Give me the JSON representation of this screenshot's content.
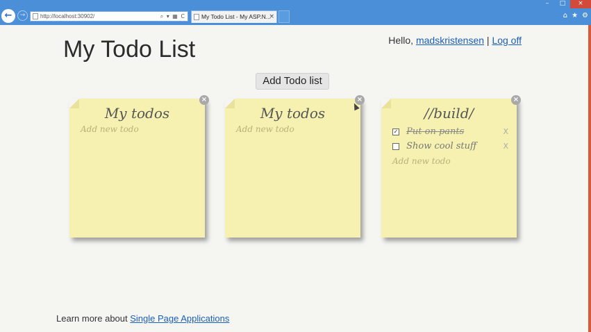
{
  "browser": {
    "address": "http://localhost:30902/",
    "tab_title": "My Todo List - My ASP.N...",
    "tab_close": "×",
    "address_tools": "⌕ ▾ ▦ C",
    "window_controls": {
      "minimize": "–",
      "maximize": "□",
      "close": "×"
    },
    "icons": [
      "home-icon",
      "star-icon",
      "gear-icon"
    ]
  },
  "page": {
    "title": "My Todo List",
    "greeting": "Hello,",
    "username": "madskristensen",
    "separator": "|",
    "logoff": "Log off",
    "add_list_button": "Add Todo list"
  },
  "lists": [
    {
      "title": "My todos",
      "items": [],
      "add_placeholder": "Add new todo"
    },
    {
      "title": "My todos",
      "items": [],
      "add_placeholder": "Add new todo"
    },
    {
      "title": "//build/",
      "items": [
        {
          "text": "Put on pants",
          "done": true,
          "check": "✓",
          "delete": "X"
        },
        {
          "text": "Show cool stuff",
          "done": false,
          "check": "",
          "delete": "X"
        }
      ],
      "add_placeholder": "Add new todo"
    }
  ],
  "note_close": "×",
  "footer": {
    "text": "Learn more about",
    "link": "Single Page Applications"
  },
  "colors": {
    "note": "#f6f1b0",
    "link": "#1a5eb8",
    "chrome": "#4a8fd8"
  }
}
